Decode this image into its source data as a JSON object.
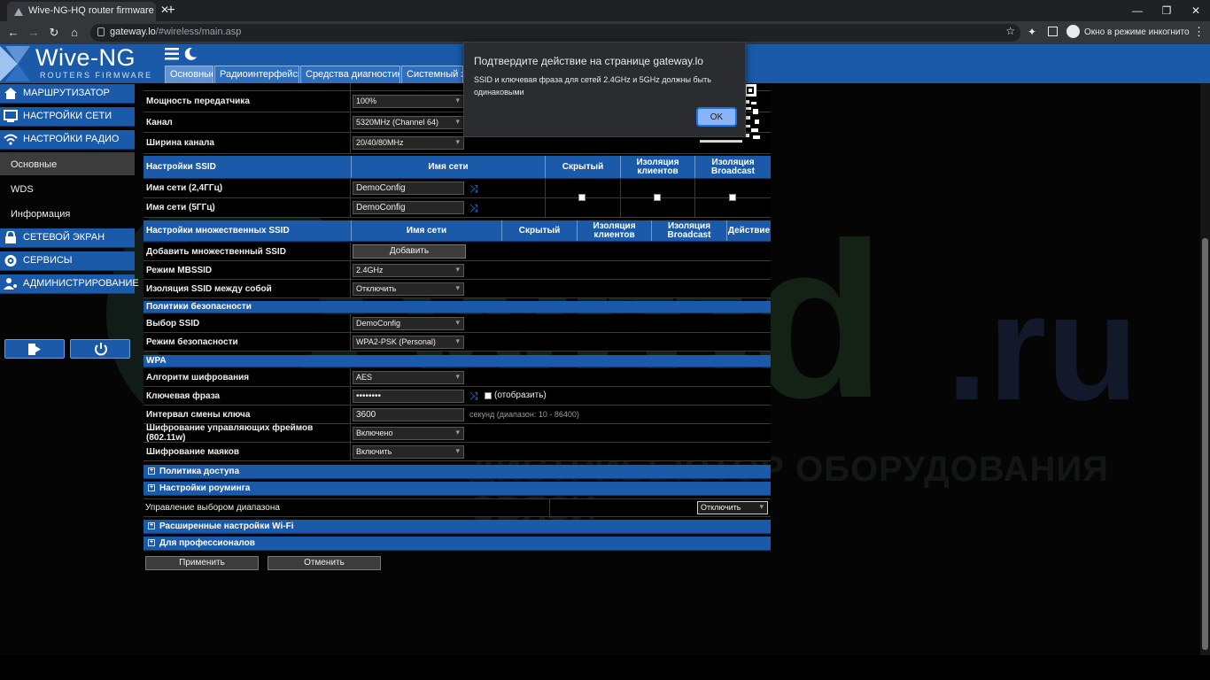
{
  "browser": {
    "tab_title": "Wive-NG-HQ router firmware - I",
    "tab_close": "✕",
    "new_tab": "+",
    "url_host": "gateway.lo",
    "url_path": "/#wireless/main.asp",
    "incognito_label": "Окно в режиме инкогнито",
    "window_min": "—",
    "window_max": "❐",
    "window_close": "✕"
  },
  "header": {
    "logo_title": "Wive-NG",
    "logo_subtitle": "ROUTERS FIRMWARE",
    "tabs": [
      "Основные",
      "Радиоинтерфейсы",
      "Средства диагностики",
      "Системный жу"
    ]
  },
  "sidebar": {
    "items": [
      {
        "label": "МАРШРУТИЗАТОР",
        "icon": "home-icon"
      },
      {
        "label": "НАСТРОЙКИ СЕТИ",
        "icon": "network-icon"
      },
      {
        "label": "НАСТРОЙКИ РАДИО",
        "icon": "wifi-icon"
      }
    ],
    "sub_items": [
      "Основные",
      "WDS",
      "Информация"
    ],
    "items2": [
      {
        "label": "СЕТЕВОЙ ЭКРАН",
        "icon": "firewall-icon"
      },
      {
        "label": "СЕРВИСЫ",
        "icon": "services-icon"
      },
      {
        "label": "АДМИНИСТРИРОВАНИЕ",
        "icon": "admin-icon"
      }
    ]
  },
  "radio": {
    "power_label": "Мощность передатчика",
    "power_value": "100%",
    "channel_label": "Канал",
    "channel_value": "5320MHz (Channel 64)",
    "width_label": "Ширина канала",
    "width_value": "20/40/80MHz"
  },
  "ssid": {
    "header": "Настройки SSID",
    "col_name": "Имя сети",
    "col_hidden": "Скрытый",
    "col_isolation": "Изоляция клиентов",
    "col_broadcast": "Изоляция Broadcast",
    "row1_label": "Имя сети (2,4ГГц)",
    "row1_value": "DemoConfig",
    "row2_label": "Имя сети (5ГГц)",
    "row2_value": "DemoConfig"
  },
  "mbssid": {
    "header": "Настройки множественных SSID",
    "col_name": "Имя сети",
    "col_hidden": "Скрытый",
    "col_isolation": "Изоляция клиентов",
    "col_broadcast": "Изоляция Broadcast",
    "col_action": "Действие",
    "add_label": "Добавить множественный SSID",
    "add_button": "Добавить",
    "mode_label": "Режим MBSSID",
    "mode_value": "2.4GHz",
    "iso_label": "Изоляция SSID между собой",
    "iso_value": "Отключить"
  },
  "security": {
    "header": "Политики безопасности",
    "ssid_label": "Выбор SSID",
    "ssid_value": "DemoConfig",
    "mode_label": "Режим безопасности",
    "mode_value": "WPA2-PSK (Personal)"
  },
  "wpa": {
    "header": "WPA",
    "algo_label": "Алгоритм шифрования",
    "algo_value": "AES",
    "key_label": "Ключевая фраза",
    "key_value": "••••••••",
    "show_label": "(отобразить)",
    "interval_label": "Интервал смены ключа",
    "interval_value": "3600",
    "interval_hint": "секунд (диапазон: 10 - 86400)",
    "pmf_label": "Шифрование управляющих фреймов (802.11w)",
    "pmf_value": "Включено",
    "beacon_label": "Шифрование маяков",
    "beacon_value": "Включить"
  },
  "sections": {
    "access_policy": "Политика доступа",
    "roaming": "Настройки роуминга",
    "band_steering_label": "Управление выбором диапазона",
    "band_steering_value": "Отключить",
    "advanced_wifi": "Расширенные настройки Wi-Fi",
    "pro": "Для профессионалов",
    "expand_symbol": "+"
  },
  "actions": {
    "apply": "Применить",
    "cancel": "Отменить"
  },
  "dialog": {
    "title": "Подтвердите действие на странице gateway.lo",
    "message": "SSID и ключевая фраза для сетей 2.4GHz и 5GHz должны быть одинаковыми",
    "ok": "OK"
  },
  "watermark": {
    "text": "wmd",
    "suffix": ".ru",
    "subtitle": "ДИСТРИБЬЮТОР ОБОРУДОВАНИЯ СВЯЗИ"
  },
  "colors": {
    "brand_blue": "#1a5aa8",
    "dialog_ok": "#8ab4f8"
  }
}
